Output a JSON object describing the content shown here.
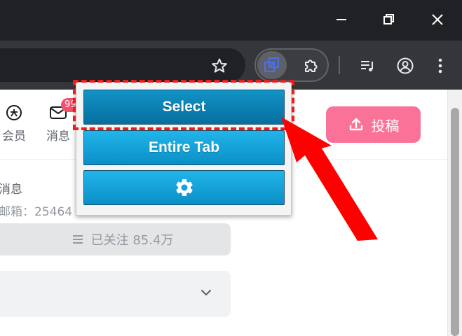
{
  "window_controls": {
    "minimize": "minimize-icon",
    "restore": "restore-icon",
    "close": "close-icon"
  },
  "toolbar": {
    "bookmark_icon": "star-icon",
    "active_extension_icon": "screenshot-extension-icon",
    "extensions_icon": "puzzle-icon",
    "media_icon": "media-queue-icon",
    "profile_icon": "profile-icon",
    "menu_icon": "kebab-menu-icon"
  },
  "page": {
    "nav_vip_label": "会员",
    "nav_message_label": "消息",
    "message_badge": "99",
    "upload_label": "投稿",
    "msg_title": "消息",
    "msg_sub": "邮箱：25464",
    "follow_label": "已关注 85.4万"
  },
  "popup": {
    "select_label": "Select",
    "entire_tab_label": "Entire Tab",
    "settings_icon": "gear-icon"
  },
  "colors": {
    "accent_pink": "#fb7299",
    "popup_button": "#10a3dc",
    "highlight_red": "#ee1c1c",
    "chrome_dark": "#202124"
  }
}
